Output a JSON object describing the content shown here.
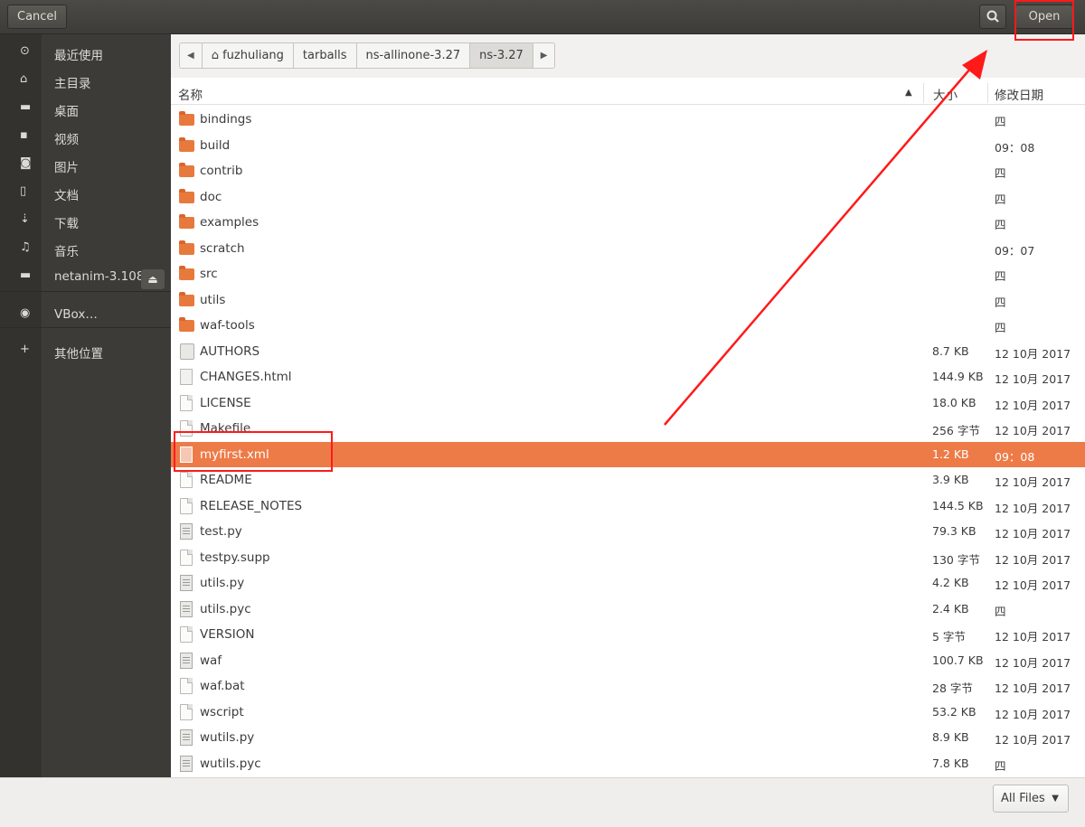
{
  "header": {
    "cancel_label": "Cancel",
    "open_label": "Open",
    "search_icon": "search-icon"
  },
  "sidebar": {
    "items": [
      {
        "icon": "clock-icon",
        "label": "最近使用"
      },
      {
        "icon": "home-icon",
        "label": "主目录"
      },
      {
        "icon": "folder-icon",
        "label": "桌面"
      },
      {
        "icon": "video-icon",
        "label": "视频"
      },
      {
        "icon": "camera-icon",
        "label": "图片"
      },
      {
        "icon": "document-icon",
        "label": "文档"
      },
      {
        "icon": "download-icon",
        "label": "下载"
      },
      {
        "icon": "music-icon",
        "label": "音乐"
      },
      {
        "icon": "folder-icon",
        "label": "netanim-3.108"
      },
      {
        "icon": "disc-icon",
        "label": "VBox…"
      },
      {
        "icon": "plus-icon",
        "label": "其他位置"
      }
    ]
  },
  "pathbar": {
    "segments": [
      "fuzhuliang",
      "tarballs",
      "ns-allinone-3.27",
      "ns-3.27"
    ]
  },
  "columns": {
    "name": "名称",
    "size": "大小",
    "modified": "修改日期"
  },
  "files": [
    {
      "name": "bindings",
      "type": "folder",
      "size": "",
      "date": "四"
    },
    {
      "name": "build",
      "type": "folder",
      "size": "",
      "date": "09：08"
    },
    {
      "name": "contrib",
      "type": "folder",
      "size": "",
      "date": "四"
    },
    {
      "name": "doc",
      "type": "folder",
      "size": "",
      "date": "四"
    },
    {
      "name": "examples",
      "type": "folder",
      "size": "",
      "date": "四"
    },
    {
      "name": "scratch",
      "type": "folder",
      "size": "",
      "date": "09：07"
    },
    {
      "name": "src",
      "type": "folder",
      "size": "",
      "date": "四"
    },
    {
      "name": "utils",
      "type": "folder",
      "size": "",
      "date": "四"
    },
    {
      "name": "waf-tools",
      "type": "folder",
      "size": "",
      "date": "四"
    },
    {
      "name": "AUTHORS",
      "type": "author",
      "size": "8.7 KB",
      "date": "12 10月 2017"
    },
    {
      "name": "CHANGES.html",
      "type": "html",
      "size": "144.9 KB",
      "date": "12 10月 2017"
    },
    {
      "name": "LICENSE",
      "type": "file",
      "size": "18.0 KB",
      "date": "12 10月 2017"
    },
    {
      "name": "Makefile",
      "type": "file",
      "size": "256 字节",
      "date": "12 10月 2017"
    },
    {
      "name": "myfirst.xml",
      "type": "html",
      "size": "1.2 KB",
      "date": "09：08",
      "selected": true
    },
    {
      "name": "README",
      "type": "file",
      "size": "3.9 KB",
      "date": "12 10月 2017"
    },
    {
      "name": "RELEASE_NOTES",
      "type": "file",
      "size": "144.5 KB",
      "date": "12 10月 2017"
    },
    {
      "name": "test.py",
      "type": "script",
      "size": "79.3 KB",
      "date": "12 10月 2017"
    },
    {
      "name": "testpy.supp",
      "type": "file",
      "size": "130 字节",
      "date": "12 10月 2017"
    },
    {
      "name": "utils.py",
      "type": "script",
      "size": "4.2 KB",
      "date": "12 10月 2017"
    },
    {
      "name": "utils.pyc",
      "type": "script",
      "size": "2.4 KB",
      "date": "四"
    },
    {
      "name": "VERSION",
      "type": "file",
      "size": "5 字节",
      "date": "12 10月 2017"
    },
    {
      "name": "waf",
      "type": "script",
      "size": "100.7 KB",
      "date": "12 10月 2017"
    },
    {
      "name": "waf.bat",
      "type": "file",
      "size": "28 字节",
      "date": "12 10月 2017"
    },
    {
      "name": "wscript",
      "type": "file",
      "size": "53.2 KB",
      "date": "12 10月 2017"
    },
    {
      "name": "wutils.py",
      "type": "script",
      "size": "8.9 KB",
      "date": "12 10月 2017"
    },
    {
      "name": "wutils.pyc",
      "type": "script",
      "size": "7.8 KB",
      "date": "四"
    }
  ],
  "filter": {
    "label": "All Files"
  },
  "colors": {
    "selection": "#ed7b48",
    "annotation": "#ff1a1a",
    "sidebar_bg": "#3c3b37"
  }
}
